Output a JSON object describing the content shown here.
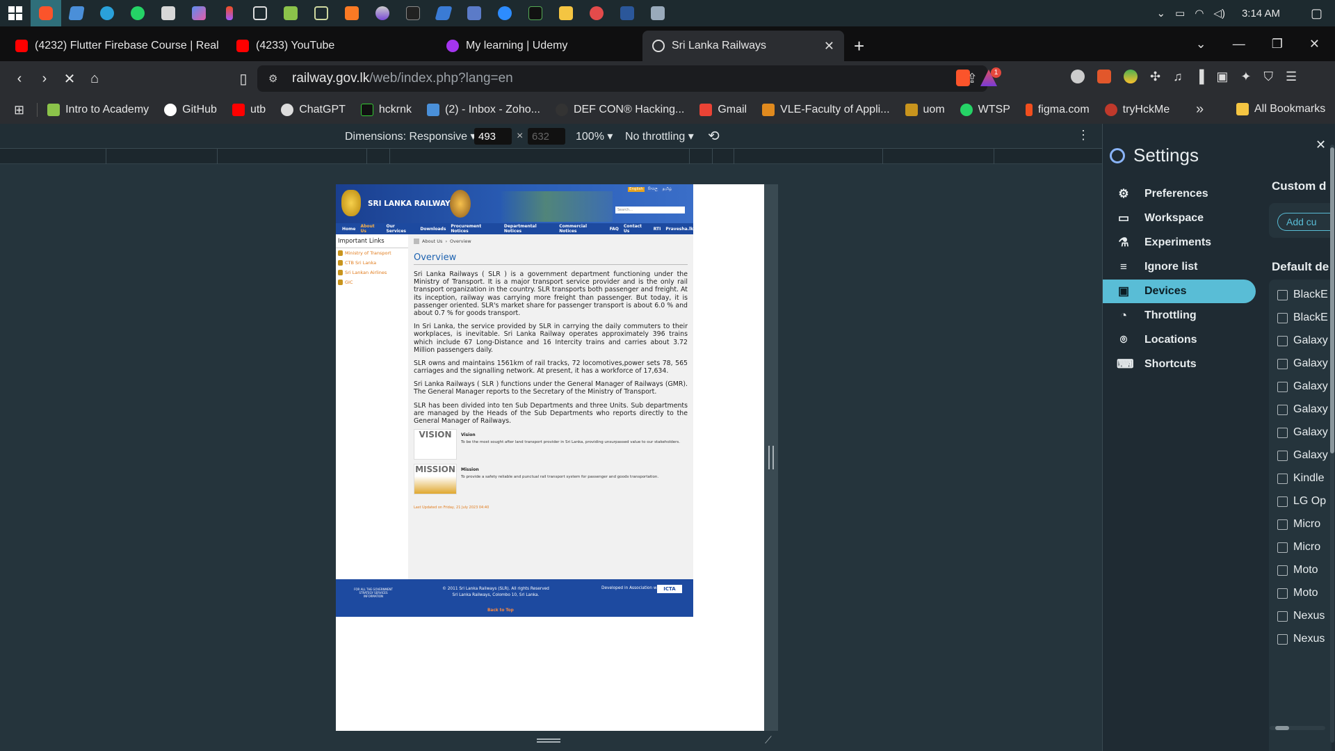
{
  "taskbar": {
    "time": "3:14 AM",
    "icons": [
      "windows-start-icon",
      "brave-icon",
      "edge-icon",
      "telegram-icon",
      "whatsapp-icon",
      "app-icon",
      "copilot-icon",
      "figma-icon",
      "cube-icon",
      "notepad-icon",
      "code-icon",
      "xampp-icon",
      "disk-icon",
      "terminal-icon",
      "azure-icon",
      "network-icon",
      "zoom-icon",
      "terminal-icon",
      "folder-icon",
      "cloud-icon",
      "word-icon",
      "image-icon"
    ]
  },
  "tabs": [
    {
      "title": "(4232) Flutter Firebase Course | Real",
      "icon": "youtube-icon",
      "color": "#ff0000"
    },
    {
      "title": "(4233) YouTube",
      "icon": "youtube-icon",
      "color": "#ff0000"
    },
    {
      "title": "My learning | Udemy",
      "icon": "udemy-icon",
      "color": "#a435f0"
    },
    {
      "title": "Sri Lanka Railways",
      "icon": "railway-icon",
      "color": "#dddddd",
      "active": true
    }
  ],
  "address": {
    "host": "railway.gov.lk",
    "path": "/web/index.php?lang=en"
  },
  "brave_badge": "1",
  "bookmarks": [
    {
      "label": "Intro to Academy",
      "color": "#8bc34a"
    },
    {
      "label": "GitHub",
      "color": "#ffffff"
    },
    {
      "label": "utb",
      "color": "#ff0000"
    },
    {
      "label": "ChatGPT",
      "color": "#dddddd"
    },
    {
      "label": "hckrnk",
      "color": "#111111"
    },
    {
      "label": "(2) - Inbox - Zoho...",
      "color": "#4a90d9"
    },
    {
      "label": "DEF CON® Hacking...",
      "color": "#333333"
    },
    {
      "label": "Gmail",
      "color": "#ea4335"
    },
    {
      "label": "VLE-Faculty of Appli...",
      "color": "#e08a1e"
    },
    {
      "label": "uom",
      "color": "#c8941d"
    },
    {
      "label": "WTSP",
      "color": "#25d366"
    },
    {
      "label": "figma.com",
      "color": "#f24e1e"
    },
    {
      "label": "tryHckMe",
      "color": "#c0392b"
    }
  ],
  "bookmarks_more": "»",
  "all_bookmarks": "All Bookmarks",
  "devtools": {
    "dimensions_label": "Dimensions: Responsive ▾",
    "width": "493",
    "times": "×",
    "height": "632",
    "zoom": "100% ▾",
    "throttling": "No throttling ▾"
  },
  "site": {
    "brand": "SRI LANKA RAILWAYS",
    "lang_links": [
      "English",
      "සිංහල",
      "தமிழ்"
    ],
    "search_placeholder": "Search...",
    "menu": [
      "Home",
      "About Us",
      "Our Services",
      "Downloads",
      "Procurement Notices",
      "Departmental Notices",
      "Commercial Notices",
      "FAQ",
      "Contact Us",
      "RTI",
      "Pravesha.lk"
    ],
    "links_header": "Important Links",
    "links": [
      "Ministry of Transport",
      "CTB Sri Lanka",
      "Sri Lankan Airlines",
      "GIC"
    ],
    "breadcrumb": [
      "About Us",
      "Overview"
    ],
    "title": "Overview",
    "paragraphs": [
      "Sri Lanka Railways ( SLR ) is a government department functioning under the Ministry of Transport. It is a major transport service provider and is the only rail transport organization in the country. SLR transports both passenger and freight. At its inception, railway was carrying more freight than passenger. But today, it is passenger oriented. SLR's market share for passenger transport is about 6.0 % and about 0.7 % for goods transport.",
      "In Sri Lanka, the service provided by SLR in carrying the daily commuters to their workplaces, is inevitable. Sri Lanka Railway operates approximately 396 trains which include 67 Long-Distance and 16 Intercity trains and carries about 3.72 Million passengers daily.",
      "SLR owns and maintains 1561km of rail tracks, 72 locomotives,power sets 78, 565 carriages and the signalling network. At present, it has a workforce of 17,634.",
      "Sri Lanka Railways ( SLR ) functions under the General Manager of Railways (GMR). The General Manager reports to the Secretary of the Ministry of Transport.",
      "SLR has been divided into ten Sub Departments and three Units. Sub departments are managed by the Heads of the Sub Departments who reports directly to the General Manager of Railways."
    ],
    "vision_img": "VISION",
    "vision_title": "Vision",
    "vision_text": "To be the most sought after land transport provider in Sri Lanka, providing unsurpassed value to our stakeholders.",
    "mission_img": "MISSION",
    "mission_title": "Mission",
    "mission_text": "To provide a safety reliable and punctual rail transport system for passenger and goods transportation.",
    "updated": "Last Updated on Friday, 21 July 2023 04:40",
    "footer_left": "FOR ALL THE GOVERNMENT STRATEGY SERVICES INFORMATION",
    "footer_copy": "© 2011 Sri Lanka Railways (SLR). All rights Reserved Sri Lanka Railways, Colombo 10, Sri Lanka.",
    "footer_dev": "Developed in Association with",
    "footer_dev_logo": "ICTA",
    "back_to_top": "Back to Top"
  },
  "settings": {
    "title": "Settings",
    "items": [
      {
        "label": "Preferences",
        "icon": "gear-icon"
      },
      {
        "label": "Workspace",
        "icon": "folder-icon"
      },
      {
        "label": "Experiments",
        "icon": "flask-icon"
      },
      {
        "label": "Ignore list",
        "icon": "ignore-icon"
      },
      {
        "label": "Devices",
        "icon": "devices-icon",
        "active": true
      },
      {
        "label": "Throttling",
        "icon": "gauge-icon"
      },
      {
        "label": "Locations",
        "icon": "pin-icon"
      },
      {
        "label": "Shortcuts",
        "icon": "keyboard-icon"
      }
    ],
    "custom_heading": "Custom d",
    "add_button": "Add cu",
    "default_heading": "Default de",
    "devices": [
      "BlackE",
      "BlackE",
      "Galaxy",
      "Galaxy",
      "Galaxy",
      "Galaxy",
      "Galaxy",
      "Galaxy",
      "Kindle",
      "LG Op",
      "Micro",
      "Micro",
      "Moto",
      "Moto",
      "Nexus",
      "Nexus"
    ]
  }
}
